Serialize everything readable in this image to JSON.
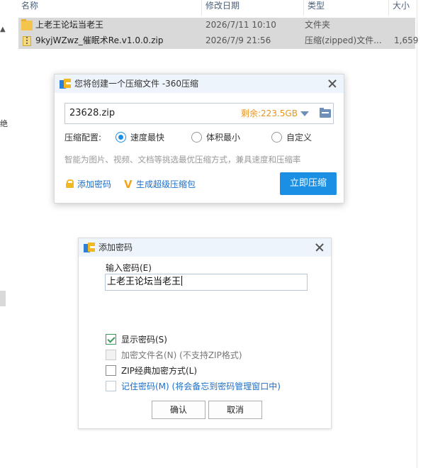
{
  "explorer": {
    "columns": [
      "名称",
      "修改日期",
      "类型",
      "大小"
    ],
    "left_fragment": "绝",
    "files": [
      {
        "name": "上老王论坛当老王",
        "date": "2026/7/11 10:10",
        "type": "文件夹",
        "size": "",
        "icon": "folder-icon"
      },
      {
        "name": "9kyjWZwz_催眠术Re.v1.0.0.zip",
        "date": "2026/7/9 21:56",
        "type": "压缩(zipped)文件...",
        "size": "1,659",
        "icon": "zip-icon"
      }
    ]
  },
  "compress_dialog": {
    "title": "您将创建一个压缩文件 -360压缩",
    "filename": "23628.zip",
    "remaining": "剩余:223.5GB",
    "config_label": "压缩配置:",
    "options": [
      {
        "label": "速度最快",
        "checked": true
      },
      {
        "label": "体积最小",
        "checked": false
      },
      {
        "label": "自定义",
        "checked": false
      }
    ],
    "hint": "智能为图片、视频、文档等挑选最优压缩方式，兼具速度和压缩率",
    "add_password": "添加密码",
    "make_super": "生成超级压缩包",
    "compress_now": "立即压缩",
    "accent": "#1a8fe3",
    "remain_color": "#e8951c"
  },
  "password_dialog": {
    "title": "添加密码",
    "input_label": "输入密码(E)",
    "password": "上老王论坛当老王",
    "checkboxes": [
      {
        "label": "显示密码(S)",
        "checked": true,
        "disabled": false
      },
      {
        "label": "加密文件名(N) (不支持ZIP格式)",
        "checked": false,
        "disabled": true
      },
      {
        "label": "ZIP经典加密方式(L)",
        "checked": false,
        "disabled": false
      },
      {
        "label": "记住密码(M) (将会备忘到密码管理窗口中)",
        "checked": false,
        "disabled": false
      }
    ],
    "ok": "确认",
    "cancel": "取消"
  }
}
